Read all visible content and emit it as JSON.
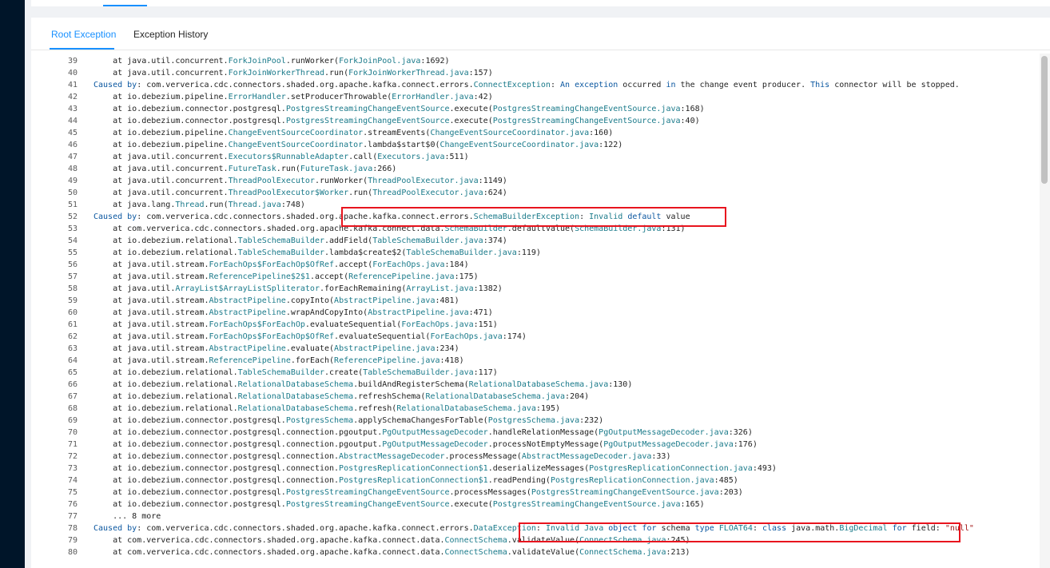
{
  "tabs": [
    {
      "label": "Root Exception",
      "active": true
    },
    {
      "label": "Exception History",
      "active": false
    }
  ],
  "colors": {
    "accent": "#1890ff",
    "sidebar": "#001529",
    "keyword": "#0b57a0",
    "class_ref": "#1a7a8a",
    "string": "#a31515",
    "highlight_box": "#e8141e"
  },
  "log_lines": [
    {
      "num": "39",
      "tokens": [
        {
          "t": "    at java.util.concurrent."
        },
        {
          "c": "ForkJoinPool"
        },
        {
          "t": ".runWorker("
        },
        {
          "c": "ForkJoinPool.java"
        },
        {
          "t": ":1692)"
        }
      ]
    },
    {
      "num": "40",
      "tokens": [
        {
          "t": "    at java.util.concurrent."
        },
        {
          "c": "ForkJoinWorkerThread"
        },
        {
          "t": ".run("
        },
        {
          "c": "ForkJoinWorkerThread.java"
        },
        {
          "t": ":157)"
        }
      ]
    },
    {
      "num": "41",
      "tokens": [
        {
          "k": "Caused by"
        },
        {
          "t": ": com.ververica.cdc.connectors.shaded.org.apache.kafka.connect.errors."
        },
        {
          "c": "ConnectException"
        },
        {
          "t": ": "
        },
        {
          "k": "An"
        },
        {
          "t": " "
        },
        {
          "k": "exception"
        },
        {
          "t": " occurred "
        },
        {
          "k": "in"
        },
        {
          "t": " the change event producer. "
        },
        {
          "k": "This"
        },
        {
          "t": " connector will be stopped."
        }
      ]
    },
    {
      "num": "42",
      "tokens": [
        {
          "t": "    at io.debezium.pipeline."
        },
        {
          "c": "ErrorHandler"
        },
        {
          "t": ".setProducerThrowable("
        },
        {
          "c": "ErrorHandler.java"
        },
        {
          "t": ":42)"
        }
      ]
    },
    {
      "num": "43",
      "tokens": [
        {
          "t": "    at io.debezium.connector.postgresql."
        },
        {
          "c": "PostgresStreamingChangeEventSource"
        },
        {
          "t": ".execute("
        },
        {
          "c": "PostgresStreamingChangeEventSource.java"
        },
        {
          "t": ":168)"
        }
      ]
    },
    {
      "num": "44",
      "tokens": [
        {
          "t": "    at io.debezium.connector.postgresql."
        },
        {
          "c": "PostgresStreamingChangeEventSource"
        },
        {
          "t": ".execute("
        },
        {
          "c": "PostgresStreamingChangeEventSource.java"
        },
        {
          "t": ":40)"
        }
      ]
    },
    {
      "num": "45",
      "tokens": [
        {
          "t": "    at io.debezium.pipeline."
        },
        {
          "c": "ChangeEventSourceCoordinator"
        },
        {
          "t": ".streamEvents("
        },
        {
          "c": "ChangeEventSourceCoordinator.java"
        },
        {
          "t": ":160)"
        }
      ]
    },
    {
      "num": "46",
      "tokens": [
        {
          "t": "    at io.debezium.pipeline."
        },
        {
          "c": "ChangeEventSourceCoordinator"
        },
        {
          "t": ".lambda$start$0("
        },
        {
          "c": "ChangeEventSourceCoordinator.java"
        },
        {
          "t": ":122)"
        }
      ]
    },
    {
      "num": "47",
      "tokens": [
        {
          "t": "    at java.util.concurrent."
        },
        {
          "c": "Executors$RunnableAdapter"
        },
        {
          "t": ".call("
        },
        {
          "c": "Executors.java"
        },
        {
          "t": ":511)"
        }
      ]
    },
    {
      "num": "48",
      "tokens": [
        {
          "t": "    at java.util.concurrent."
        },
        {
          "c": "FutureTask"
        },
        {
          "t": ".run("
        },
        {
          "c": "FutureTask.java"
        },
        {
          "t": ":266)"
        }
      ]
    },
    {
      "num": "49",
      "tokens": [
        {
          "t": "    at java.util.concurrent."
        },
        {
          "c": "ThreadPoolExecutor"
        },
        {
          "t": ".runWorker("
        },
        {
          "c": "ThreadPoolExecutor.java"
        },
        {
          "t": ":1149)"
        }
      ]
    },
    {
      "num": "50",
      "tokens": [
        {
          "t": "    at java.util.concurrent."
        },
        {
          "c": "ThreadPoolExecutor$Worker"
        },
        {
          "t": ".run("
        },
        {
          "c": "ThreadPoolExecutor.java"
        },
        {
          "t": ":624)"
        }
      ]
    },
    {
      "num": "51",
      "tokens": [
        {
          "t": "    at java.lang."
        },
        {
          "c": "Thread"
        },
        {
          "t": ".run("
        },
        {
          "c": "Thread.java"
        },
        {
          "t": ":748)"
        }
      ]
    },
    {
      "num": "52",
      "tokens": [
        {
          "k": "Caused by"
        },
        {
          "t": ": com.ververica.cdc.connectors.shaded.org.apache.kafka.connect.errors."
        },
        {
          "c": "SchemaBuilderException"
        },
        {
          "t": ": "
        },
        {
          "c": "Invalid"
        },
        {
          "t": " "
        },
        {
          "k": "default"
        },
        {
          "t": " value"
        }
      ]
    },
    {
      "num": "53",
      "tokens": [
        {
          "t": "    at com.ververica.cdc.connectors.shaded.org.apache.kafka.connect.data."
        },
        {
          "c": "SchemaBuilder"
        },
        {
          "t": ".defaultValue("
        },
        {
          "c": "SchemaBuilder.java"
        },
        {
          "t": ":131)"
        }
      ]
    },
    {
      "num": "54",
      "tokens": [
        {
          "t": "    at io.debezium.relational."
        },
        {
          "c": "TableSchemaBuilder"
        },
        {
          "t": ".addField("
        },
        {
          "c": "TableSchemaBuilder.java"
        },
        {
          "t": ":374)"
        }
      ]
    },
    {
      "num": "55",
      "tokens": [
        {
          "t": "    at io.debezium.relational."
        },
        {
          "c": "TableSchemaBuilder"
        },
        {
          "t": ".lambda$create$2("
        },
        {
          "c": "TableSchemaBuilder.java"
        },
        {
          "t": ":119)"
        }
      ]
    },
    {
      "num": "56",
      "tokens": [
        {
          "t": "    at java.util.stream."
        },
        {
          "c": "ForEachOps$ForEachOp$OfRef"
        },
        {
          "t": ".accept("
        },
        {
          "c": "ForEachOps.java"
        },
        {
          "t": ":184)"
        }
      ]
    },
    {
      "num": "57",
      "tokens": [
        {
          "t": "    at java.util.stream."
        },
        {
          "c": "ReferencePipeline$2$1"
        },
        {
          "t": ".accept("
        },
        {
          "c": "ReferencePipeline.java"
        },
        {
          "t": ":175)"
        }
      ]
    },
    {
      "num": "58",
      "tokens": [
        {
          "t": "    at java.util."
        },
        {
          "c": "ArrayList$ArrayListSpliterator"
        },
        {
          "t": ".forEachRemaining("
        },
        {
          "c": "ArrayList.java"
        },
        {
          "t": ":1382)"
        }
      ]
    },
    {
      "num": "59",
      "tokens": [
        {
          "t": "    at java.util.stream."
        },
        {
          "c": "AbstractPipeline"
        },
        {
          "t": ".copyInto("
        },
        {
          "c": "AbstractPipeline.java"
        },
        {
          "t": ":481)"
        }
      ]
    },
    {
      "num": "60",
      "tokens": [
        {
          "t": "    at java.util.stream."
        },
        {
          "c": "AbstractPipeline"
        },
        {
          "t": ".wrapAndCopyInto("
        },
        {
          "c": "AbstractPipeline.java"
        },
        {
          "t": ":471)"
        }
      ]
    },
    {
      "num": "61",
      "tokens": [
        {
          "t": "    at java.util.stream."
        },
        {
          "c": "ForEachOps$ForEachOp"
        },
        {
          "t": ".evaluateSequential("
        },
        {
          "c": "ForEachOps.java"
        },
        {
          "t": ":151)"
        }
      ]
    },
    {
      "num": "62",
      "tokens": [
        {
          "t": "    at java.util.stream."
        },
        {
          "c": "ForEachOps$ForEachOp$OfRef"
        },
        {
          "t": ".evaluateSequential("
        },
        {
          "c": "ForEachOps.java"
        },
        {
          "t": ":174)"
        }
      ]
    },
    {
      "num": "63",
      "tokens": [
        {
          "t": "    at java.util.stream."
        },
        {
          "c": "AbstractPipeline"
        },
        {
          "t": ".evaluate("
        },
        {
          "c": "AbstractPipeline.java"
        },
        {
          "t": ":234)"
        }
      ]
    },
    {
      "num": "64",
      "tokens": [
        {
          "t": "    at java.util.stream."
        },
        {
          "c": "ReferencePipeline"
        },
        {
          "t": ".forEach("
        },
        {
          "c": "ReferencePipeline.java"
        },
        {
          "t": ":418)"
        }
      ]
    },
    {
      "num": "65",
      "tokens": [
        {
          "t": "    at io.debezium.relational."
        },
        {
          "c": "TableSchemaBuilder"
        },
        {
          "t": ".create("
        },
        {
          "c": "TableSchemaBuilder.java"
        },
        {
          "t": ":117)"
        }
      ]
    },
    {
      "num": "66",
      "tokens": [
        {
          "t": "    at io.debezium.relational."
        },
        {
          "c": "RelationalDatabaseSchema"
        },
        {
          "t": ".buildAndRegisterSchema("
        },
        {
          "c": "RelationalDatabaseSchema.java"
        },
        {
          "t": ":130)"
        }
      ]
    },
    {
      "num": "67",
      "tokens": [
        {
          "t": "    at io.debezium.relational."
        },
        {
          "c": "RelationalDatabaseSchema"
        },
        {
          "t": ".refreshSchema("
        },
        {
          "c": "RelationalDatabaseSchema.java"
        },
        {
          "t": ":204)"
        }
      ]
    },
    {
      "num": "68",
      "tokens": [
        {
          "t": "    at io.debezium.relational."
        },
        {
          "c": "RelationalDatabaseSchema"
        },
        {
          "t": ".refresh("
        },
        {
          "c": "RelationalDatabaseSchema.java"
        },
        {
          "t": ":195)"
        }
      ]
    },
    {
      "num": "69",
      "tokens": [
        {
          "t": "    at io.debezium.connector.postgresql."
        },
        {
          "c": "PostgresSchema"
        },
        {
          "t": ".applySchemaChangesForTable("
        },
        {
          "c": "PostgresSchema.java"
        },
        {
          "t": ":232)"
        }
      ]
    },
    {
      "num": "70",
      "tokens": [
        {
          "t": "    at io.debezium.connector.postgresql.connection.pgoutput."
        },
        {
          "c": "PgOutputMessageDecoder"
        },
        {
          "t": ".handleRelationMessage("
        },
        {
          "c": "PgOutputMessageDecoder.java"
        },
        {
          "t": ":326)"
        }
      ]
    },
    {
      "num": "71",
      "tokens": [
        {
          "t": "    at io.debezium.connector.postgresql.connection.pgoutput."
        },
        {
          "c": "PgOutputMessageDecoder"
        },
        {
          "t": ".processNotEmptyMessage("
        },
        {
          "c": "PgOutputMessageDecoder.java"
        },
        {
          "t": ":176)"
        }
      ]
    },
    {
      "num": "72",
      "tokens": [
        {
          "t": "    at io.debezium.connector.postgresql.connection."
        },
        {
          "c": "AbstractMessageDecoder"
        },
        {
          "t": ".processMessage("
        },
        {
          "c": "AbstractMessageDecoder.java"
        },
        {
          "t": ":33)"
        }
      ]
    },
    {
      "num": "73",
      "tokens": [
        {
          "t": "    at io.debezium.connector.postgresql.connection."
        },
        {
          "c": "PostgresReplicationConnection$1"
        },
        {
          "t": ".deserializeMessages("
        },
        {
          "c": "PostgresReplicationConnection.java"
        },
        {
          "t": ":493)"
        }
      ]
    },
    {
      "num": "74",
      "tokens": [
        {
          "t": "    at io.debezium.connector.postgresql.connection."
        },
        {
          "c": "PostgresReplicationConnection$1"
        },
        {
          "t": ".readPending("
        },
        {
          "c": "PostgresReplicationConnection.java"
        },
        {
          "t": ":485)"
        }
      ]
    },
    {
      "num": "75",
      "tokens": [
        {
          "t": "    at io.debezium.connector.postgresql."
        },
        {
          "c": "PostgresStreamingChangeEventSource"
        },
        {
          "t": ".processMessages("
        },
        {
          "c": "PostgresStreamingChangeEventSource.java"
        },
        {
          "t": ":203)"
        }
      ]
    },
    {
      "num": "76",
      "tokens": [
        {
          "t": "    at io.debezium.connector.postgresql."
        },
        {
          "c": "PostgresStreamingChangeEventSource"
        },
        {
          "t": ".execute("
        },
        {
          "c": "PostgresStreamingChangeEventSource.java"
        },
        {
          "t": ":165)"
        }
      ]
    },
    {
      "num": "77",
      "tokens": [
        {
          "t": "    ... 8 more"
        }
      ]
    },
    {
      "num": "78",
      "tokens": [
        {
          "k": "Caused by"
        },
        {
          "t": ": com.ververica.cdc.connectors.shaded.org.apache.kafka.connect.errors."
        },
        {
          "c": "DataException"
        },
        {
          "t": ": "
        },
        {
          "c": "Invalid"
        },
        {
          "t": " "
        },
        {
          "c": "Java"
        },
        {
          "t": " "
        },
        {
          "k": "object"
        },
        {
          "t": " "
        },
        {
          "k": "for"
        },
        {
          "t": " schema "
        },
        {
          "k": "type"
        },
        {
          "t": " "
        },
        {
          "c": "FLOAT64"
        },
        {
          "t": ": "
        },
        {
          "k": "class"
        },
        {
          "t": " java.math."
        },
        {
          "c": "BigDecimal"
        },
        {
          "t": " "
        },
        {
          "k": "for"
        },
        {
          "t": " field: "
        },
        {
          "s": "\"null\""
        }
      ]
    },
    {
      "num": "79",
      "tokens": [
        {
          "t": "    at com.ververica.cdc.connectors.shaded.org.apache.kafka.connect.data."
        },
        {
          "c": "ConnectSchema"
        },
        {
          "t": ".validateValue("
        },
        {
          "c": "ConnectSchema.java"
        },
        {
          "t": ":245)"
        }
      ]
    },
    {
      "num": "80",
      "tokens": [
        {
          "t": "    at com.ververica.cdc.connectors.shaded.org.apache.kafka.connect.data."
        },
        {
          "c": "ConnectSchema"
        },
        {
          "t": ".validateValue("
        },
        {
          "c": "ConnectSchema.java"
        },
        {
          "t": ":213)"
        }
      ]
    }
  ]
}
